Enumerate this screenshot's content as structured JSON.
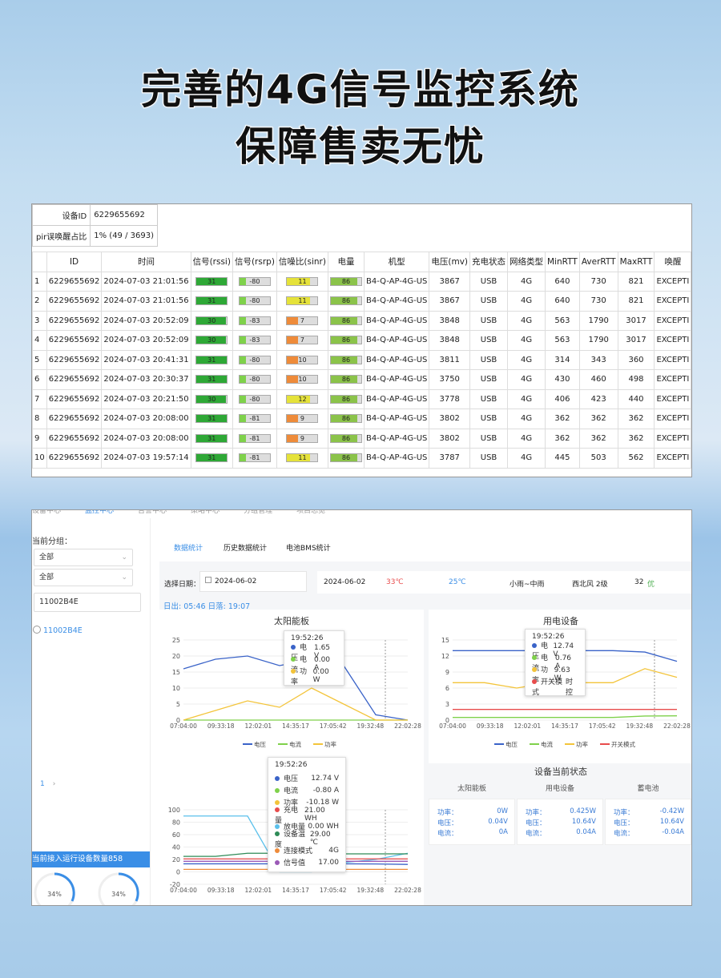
{
  "headline": {
    "line1": "完善的4G信号监控系统",
    "line2": "保障售卖无忧"
  },
  "table": {
    "kv": [
      {
        "k": "设备ID",
        "v": "6229655692"
      },
      {
        "k": "pir误唤醒占比",
        "v": "1% (49 / 3693)"
      }
    ],
    "columns": [
      "",
      "ID",
      "时间",
      "信号(rssi)",
      "信号(rsrp)",
      "信噪比(sinr)",
      "电量",
      "机型",
      "电压(mv)",
      "充电状态",
      "网络类型",
      "MinRTT",
      "AverRTT",
      "MaxRTT",
      "唤醒"
    ],
    "rows": [
      {
        "n": "1",
        "id": "6229655692",
        "t": "2024-07-03 21:01:56",
        "rssi": 31,
        "rsrp": -80,
        "sinr": 11,
        "bat": 86,
        "model": "B4-Q-AP-4G-US",
        "mv": "3867",
        "chg": "USB",
        "net": "4G",
        "min": "640",
        "avg": "730",
        "max": "821",
        "wake": "EXCEPTI"
      },
      {
        "n": "2",
        "id": "6229655692",
        "t": "2024-07-03 21:01:56",
        "rssi": 31,
        "rsrp": -80,
        "sinr": 11,
        "bat": 86,
        "model": "B4-Q-AP-4G-US",
        "mv": "3867",
        "chg": "USB",
        "net": "4G",
        "min": "640",
        "avg": "730",
        "max": "821",
        "wake": "EXCEPTI"
      },
      {
        "n": "3",
        "id": "6229655692",
        "t": "2024-07-03 20:52:09",
        "rssi": 30,
        "rsrp": -83,
        "sinr": 7,
        "bat": 86,
        "model": "B4-Q-AP-4G-US",
        "mv": "3848",
        "chg": "USB",
        "net": "4G",
        "min": "563",
        "avg": "1790",
        "max": "3017",
        "wake": "EXCEPTI"
      },
      {
        "n": "4",
        "id": "6229655692",
        "t": "2024-07-03 20:52:09",
        "rssi": 30,
        "rsrp": -83,
        "sinr": 7,
        "bat": 86,
        "model": "B4-Q-AP-4G-US",
        "mv": "3848",
        "chg": "USB",
        "net": "4G",
        "min": "563",
        "avg": "1790",
        "max": "3017",
        "wake": "EXCEPTI"
      },
      {
        "n": "5",
        "id": "6229655692",
        "t": "2024-07-03 20:41:31",
        "rssi": 31,
        "rsrp": -80,
        "sinr": 10,
        "bat": 86,
        "model": "B4-Q-AP-4G-US",
        "mv": "3811",
        "chg": "USB",
        "net": "4G",
        "min": "314",
        "avg": "343",
        "max": "360",
        "wake": "EXCEPTI"
      },
      {
        "n": "6",
        "id": "6229655692",
        "t": "2024-07-03 20:30:37",
        "rssi": 31,
        "rsrp": -80,
        "sinr": 10,
        "bat": 86,
        "model": "B4-Q-AP-4G-US",
        "mv": "3750",
        "chg": "USB",
        "net": "4G",
        "min": "430",
        "avg": "460",
        "max": "498",
        "wake": "EXCEPTI"
      },
      {
        "n": "7",
        "id": "6229655692",
        "t": "2024-07-03 20:21:50",
        "rssi": 30,
        "rsrp": -80,
        "sinr": 12,
        "bat": 86,
        "model": "B4-Q-AP-4G-US",
        "mv": "3778",
        "chg": "USB",
        "net": "4G",
        "min": "406",
        "avg": "423",
        "max": "440",
        "wake": "EXCEPTI"
      },
      {
        "n": "8",
        "id": "6229655692",
        "t": "2024-07-03 20:08:00",
        "rssi": 31,
        "rsrp": -81,
        "sinr": 9,
        "bat": 86,
        "model": "B4-Q-AP-4G-US",
        "mv": "3802",
        "chg": "USB",
        "net": "4G",
        "min": "362",
        "avg": "362",
        "max": "362",
        "wake": "EXCEPTI"
      },
      {
        "n": "9",
        "id": "6229655692",
        "t": "2024-07-03 20:08:00",
        "rssi": 31,
        "rsrp": -81,
        "sinr": 9,
        "bat": 86,
        "model": "B4-Q-AP-4G-US",
        "mv": "3802",
        "chg": "USB",
        "net": "4G",
        "min": "362",
        "avg": "362",
        "max": "362",
        "wake": "EXCEPTI"
      },
      {
        "n": "10",
        "id": "6229655692",
        "t": "2024-07-03 19:57:14",
        "rssi": 31,
        "rsrp": -81,
        "sinr": 11,
        "bat": 86,
        "model": "B4-Q-AP-4G-US",
        "mv": "3787",
        "chg": "USB",
        "net": "4G",
        "min": "445",
        "avg": "503",
        "max": "562",
        "wake": "EXCEPTI"
      }
    ]
  },
  "colors": {
    "green": "#2ea836",
    "lightgreen": "#7fd14b",
    "yellow": "#e5e23a",
    "orange": "#ee8b3a",
    "batt": "#8bc34a",
    "blue": "#3a63c8",
    "accent": "#3a8ee6"
  },
  "sidebar": {
    "group_label": "当前分组：",
    "select1": "全部",
    "select2": "全部",
    "search_value": "11002B4E",
    "device": "11002B4E",
    "page": "1",
    "count_banner": "当前接入运行设备数量858",
    "ring1": "34%",
    "ring2": "34%"
  },
  "tabs": [
    "数据统计",
    "历史数据统计",
    "电池BMS统计"
  ],
  "datebar": {
    "label": "选择日期：",
    "date": "2024-06-02",
    "weather_date": "2024-06-02",
    "high": "33℃",
    "low": "25℃",
    "weather": "小雨~中雨",
    "wind": "西北风 2级",
    "aqi": "32",
    "aqi_level": "优"
  },
  "sun": "日出: 05:46 日落: 19:07",
  "chart_data": [
    {
      "type": "line",
      "title": "太阳能板",
      "x": [
        "07:04:00",
        "09:33:18",
        "12:02:01",
        "14:35:17",
        "17:05:42",
        "19:32:48",
        "22:02:28"
      ],
      "yticks": [
        0,
        5,
        10,
        15,
        20,
        25
      ],
      "ylim": [
        0,
        25
      ],
      "series": [
        {
          "name": "电压",
          "color": "#3a63c8",
          "values": [
            16,
            19,
            20,
            17,
            19,
            17,
            1.65,
            0
          ]
        },
        {
          "name": "电流",
          "color": "#7fd14b",
          "values": [
            0,
            0,
            0,
            0,
            0,
            0,
            0,
            0
          ]
        },
        {
          "name": "功率",
          "color": "#f3c43a",
          "values": [
            0,
            3,
            6,
            4,
            10,
            5,
            0,
            0
          ]
        }
      ],
      "tooltip": {
        "time": "19:52:26",
        "rows": [
          [
            "电压",
            "1.65 V"
          ],
          [
            "电流",
            "0.00 A"
          ],
          [
            "功率",
            "0.00 W"
          ]
        ]
      }
    },
    {
      "type": "line",
      "title": "用电设备",
      "x": [
        "07:04:00",
        "09:33:18",
        "12:02:01",
        "14:35:17",
        "17:05:42",
        "19:32:48",
        "22:02:28"
      ],
      "yticks": [
        0,
        3,
        6,
        9,
        12,
        15
      ],
      "ylim": [
        0,
        15
      ],
      "series": [
        {
          "name": "电压",
          "color": "#3a63c8",
          "values": [
            13,
            13,
            13,
            13,
            13,
            13,
            12.74,
            11
          ]
        },
        {
          "name": "电流",
          "color": "#7fd14b",
          "values": [
            0.5,
            0.5,
            0.5,
            0.5,
            0.5,
            0.5,
            0.76,
            0.8
          ]
        },
        {
          "name": "功率",
          "color": "#f3c43a",
          "values": [
            7,
            7,
            6,
            7,
            7,
            7,
            9.63,
            8
          ]
        },
        {
          "name": "开关模式",
          "color": "#e84c4c",
          "values": [
            2,
            2,
            2,
            2,
            2,
            2,
            2,
            2
          ]
        }
      ],
      "tooltip": {
        "time": "19:52:26",
        "rows": [
          [
            "电压",
            "12.74 V"
          ],
          [
            "电流",
            "0.76 A"
          ],
          [
            "功率",
            "9.63 W"
          ],
          [
            "开关模式",
            "时控"
          ]
        ]
      }
    },
    {
      "type": "line",
      "title": "蓄电池",
      "x": [
        "07:04:00",
        "09:33:18",
        "12:02:01",
        "14:35:17",
        "17:05:42",
        "19:32:48",
        "22:02:28"
      ],
      "yticks": [
        -20,
        0,
        20,
        40,
        60,
        80,
        100
      ],
      "ylim": [
        -20,
        100
      ],
      "series": [
        {
          "name": "电压",
          "color": "#3a63c8",
          "values": [
            13,
            13,
            13,
            13,
            13,
            13,
            12.74,
            12
          ]
        },
        {
          "name": "放电量",
          "color": "#5bc0eb",
          "values": [
            90,
            90,
            90,
            0,
            0,
            15,
            20,
            30
          ]
        },
        {
          "name": "充电量",
          "color": "#e84c4c",
          "values": [
            21,
            21,
            21,
            21,
            21,
            21,
            21,
            21
          ]
        },
        {
          "name": "设备温度",
          "color": "#2e8b57",
          "values": [
            25,
            25,
            30,
            30,
            29,
            29,
            29,
            29
          ]
        },
        {
          "name": "连接模式",
          "color": "#ee8b3a",
          "values": [
            4,
            4,
            4,
            4,
            4,
            4,
            4,
            4
          ]
        },
        {
          "name": "信号值",
          "color": "#9b59b6",
          "values": [
            17,
            17,
            17,
            17,
            17,
            17,
            17,
            17
          ]
        }
      ],
      "tooltip": {
        "time": "19:52:26",
        "rows": [
          [
            "电压",
            "12.74 V"
          ],
          [
            "电流",
            "-0.80 A"
          ],
          [
            "功率",
            "-10.18 W"
          ],
          [
            "充电量",
            "21.00 WH"
          ],
          [
            "放电量",
            "0.00 WH"
          ],
          [
            "设备温度",
            "29.00 ℃"
          ],
          [
            "连接模式",
            "4G"
          ],
          [
            "信号值",
            "17.00"
          ]
        ]
      }
    }
  ],
  "status": {
    "title": "设备当前状态",
    "cols": [
      {
        "name": "太阳能板",
        "rows": [
          [
            "功率：",
            "0W"
          ],
          [
            "电压：",
            "0.04V"
          ],
          [
            "电流：",
            "0A"
          ]
        ]
      },
      {
        "name": "用电设备",
        "rows": [
          [
            "功率：",
            "0.425W"
          ],
          [
            "电压：",
            "10.64V"
          ],
          [
            "电流：",
            "0.04A"
          ]
        ]
      },
      {
        "name": "蓄电池",
        "rows": [
          [
            "功率：",
            "-0.42W"
          ],
          [
            "电压：",
            "10.64V"
          ],
          [
            "电流：",
            "-0.04A"
          ]
        ]
      }
    ]
  }
}
